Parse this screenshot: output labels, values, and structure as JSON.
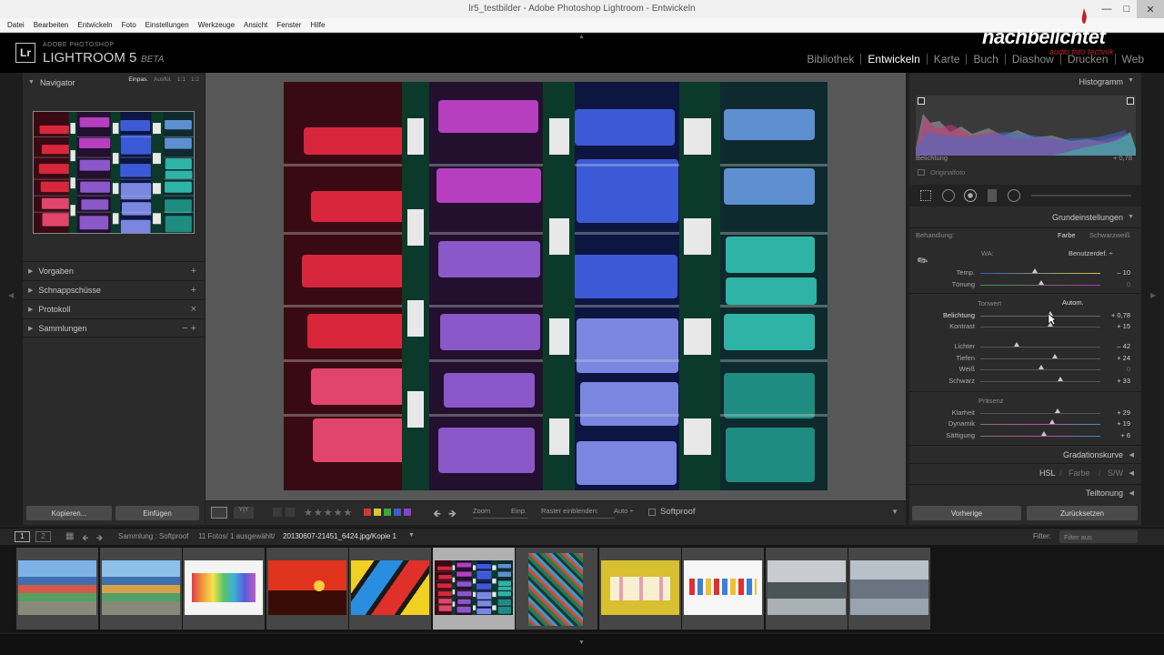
{
  "window": {
    "title": "lr5_testbilder - Adobe Photoshop Lightroom - Entwickeln"
  },
  "menu": [
    "Datei",
    "Bearbeiten",
    "Entwickeln",
    "Foto",
    "Einstellungen",
    "Werkzeuge",
    "Ansicht",
    "Fenster",
    "Hilfe"
  ],
  "brand": {
    "small": "ADOBE PHOTOSHOP",
    "big": "LIGHTROOM 5",
    "beta": "BETA",
    "logo": "Lr"
  },
  "watermark": {
    "main": "nachbelichtet",
    "sub": "audio foto technik"
  },
  "modules": [
    {
      "label": "Bibliothek",
      "active": false
    },
    {
      "label": "Entwickeln",
      "active": true
    },
    {
      "label": "Karte",
      "active": false
    },
    {
      "label": "Buch",
      "active": false
    },
    {
      "label": "Diashow",
      "active": false
    },
    {
      "label": "Drucken",
      "active": false
    },
    {
      "label": "Web",
      "active": false
    }
  ],
  "left_panel": {
    "navigator": {
      "title": "Navigator",
      "zoom": [
        "Einpas.",
        "Ausfül.",
        "1:1",
        "1:2"
      ]
    },
    "sections": [
      {
        "label": "Vorgaben",
        "action": "+"
      },
      {
        "label": "Schnappschüsse",
        "action": "+"
      },
      {
        "label": "Protokoll",
        "action": "×"
      },
      {
        "label": "Sammlungen",
        "action": "− +"
      }
    ],
    "buttons": {
      "copy": "Kopieren...",
      "paste": "Einfügen"
    }
  },
  "histogram": {
    "title": "Histogramm",
    "exposure_label": "Belichtung",
    "exposure_value": "+ 0,78",
    "original_label": "Originalfoto"
  },
  "basic": {
    "title": "Grundeinstellungen",
    "treatment_label": "Behandlung:",
    "treatment_color": "Farbe",
    "treatment_bw": "Schwarzweiß",
    "wb_label": "WA:",
    "wb_value": "Benutzerdef. ÷",
    "tone_label": "Tonwert",
    "auto_label": "Autom.",
    "presence_label": "Präsenz",
    "sliders_wb": [
      {
        "label": "Temp.",
        "value": "– 10",
        "pos": 0.45
      },
      {
        "label": "Tönung",
        "value": "0",
        "pos": 0.5
      }
    ],
    "sliders_tone": [
      {
        "label": "Belichtung",
        "value": "+ 0,78",
        "pos": 0.58
      },
      {
        "label": "Kontrast",
        "value": "+ 15",
        "pos": 0.58
      }
    ],
    "sliders_tone2": [
      {
        "label": "Lichter",
        "value": "– 42",
        "pos": 0.3
      },
      {
        "label": "Tiefen",
        "value": "+ 24",
        "pos": 0.62
      },
      {
        "label": "Weiß",
        "value": "0",
        "pos": 0.5
      },
      {
        "label": "Schwarz",
        "value": "+ 33",
        "pos": 0.67
      }
    ],
    "sliders_presence": [
      {
        "label": "Klarheit",
        "value": "+ 29",
        "pos": 0.65
      },
      {
        "label": "Dynamik",
        "value": "+ 19",
        "pos": 0.6
      },
      {
        "label": "Sättigung",
        "value": "+ 6",
        "pos": 0.53
      }
    ]
  },
  "right_sections": {
    "gradation": "Gradationskurve",
    "hsl": "HSL",
    "farbe": "Farbe",
    "sw": "S/W",
    "split": "Teiltonung"
  },
  "right_buttons": {
    "prev": "Vorherige",
    "reset": "Zurücksetzen"
  },
  "toolbar": {
    "zoom_label": "Zoom",
    "zoom_value": "Einp.",
    "grid_label": "Raster einblenden:",
    "grid_value": "Auto ÷",
    "softproof": "Softproof"
  },
  "filmbar": {
    "source": "Sammlung : Softproof",
    "info": "11 Fotos/ 1 ausgewählt/",
    "file": "20130607-21451_6424.jpg/Kopie 1",
    "filter_label": "Filter:",
    "filter_value": "Filter aus"
  },
  "colors": {
    "accent": "#ffffff",
    "label_red": "#d03838",
    "label_yellow": "#d7c634",
    "label_green": "#3fa73f",
    "label_blue": "#3d5ed1",
    "label_purple": "#8b41c4"
  }
}
